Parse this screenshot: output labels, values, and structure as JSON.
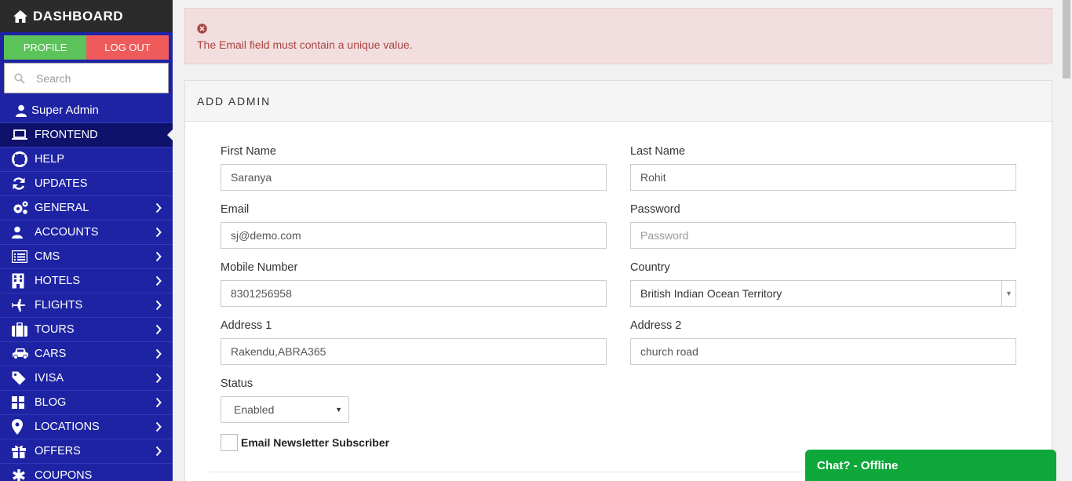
{
  "sidebar": {
    "title": "DASHBOARD",
    "profile_label": "PROFILE",
    "logout_label": "LOG OUT",
    "search_placeholder": "Search",
    "user_name": "Super Admin",
    "items": [
      {
        "label": "FRONTEND",
        "icon": "laptop-icon"
      },
      {
        "label": "HELP",
        "icon": "lifebuoy-icon"
      },
      {
        "label": "UPDATES",
        "icon": "refresh-icon"
      },
      {
        "label": "GENERAL",
        "icon": "gears-icon"
      },
      {
        "label": "ACCOUNTS",
        "icon": "user-icon"
      },
      {
        "label": "CMS",
        "icon": "list-icon"
      },
      {
        "label": "HOTELS",
        "icon": "building-icon"
      },
      {
        "label": "FLIGHTS",
        "icon": "plane-icon"
      },
      {
        "label": "TOURS",
        "icon": "suitcase-icon"
      },
      {
        "label": "CARS",
        "icon": "car-icon"
      },
      {
        "label": "IVISA",
        "icon": "tag-icon"
      },
      {
        "label": "BLOG",
        "icon": "grid-icon"
      },
      {
        "label": "LOCATIONS",
        "icon": "map-marker-icon"
      },
      {
        "label": "OFFERS",
        "icon": "gift-icon"
      },
      {
        "label": "COUPONS",
        "icon": "asterisk-icon"
      }
    ]
  },
  "alert": {
    "message": "The Email field must contain a unique value."
  },
  "form": {
    "title": "ADD ADMIN",
    "first_name": {
      "label": "First Name",
      "value": "Saranya"
    },
    "last_name": {
      "label": "Last Name",
      "value": "Rohit"
    },
    "email": {
      "label": "Email",
      "value": "sj@demo.com"
    },
    "password": {
      "label": "Password",
      "placeholder": "Password"
    },
    "mobile": {
      "label": "Mobile Number",
      "value": "8301256958"
    },
    "country": {
      "label": "Country",
      "value": "British Indian Ocean Territory"
    },
    "address1": {
      "label": "Address 1",
      "value": "Rakendu,ABRA365"
    },
    "address2": {
      "label": "Address 2",
      "value": "church road"
    },
    "status": {
      "label": "Status",
      "value": "Enabled"
    },
    "newsletter_label": "Email Newsletter Subscriber"
  },
  "chat": {
    "label": "Chat? - Offline"
  }
}
